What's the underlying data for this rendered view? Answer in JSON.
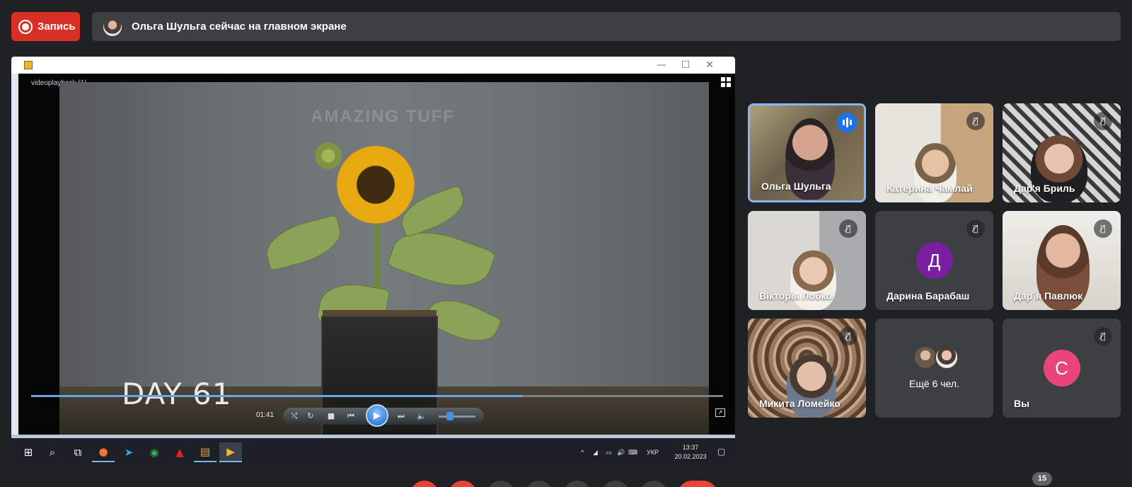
{
  "record_button": {
    "label": "Запись"
  },
  "banner": {
    "text": "Ольга Шульга сейчас на главном экране"
  },
  "shared_screen": {
    "window_controls": {
      "minimize": "—",
      "maximize": "☐",
      "close": "✕"
    },
    "video_title": "videoplayback (1)",
    "watermark": "AMAZING TUFF",
    "day_label": "DAY 61",
    "time": "01:41",
    "progress": 0.71,
    "volume": 0.3,
    "taskbar": {
      "keyboard_lang": "УКР",
      "clock_time": "13:37",
      "clock_date": "20.02.2023"
    }
  },
  "participants": [
    {
      "name": "Ольга Шульга",
      "speaking": true,
      "muted": false
    },
    {
      "name": "Катерина Чамлай",
      "speaking": false,
      "muted": true
    },
    {
      "name": "Дар'я Бриль",
      "speaking": false,
      "muted": true
    },
    {
      "name": "Вікторія Лобко",
      "speaking": false,
      "muted": true
    },
    {
      "name": "Дарина Барабаш",
      "speaking": false,
      "muted": true,
      "initial": "Д",
      "color": "#7b1fa2"
    },
    {
      "name": "Дар`я Павлюк",
      "speaking": false,
      "muted": true
    },
    {
      "name": "Микита Ломейко",
      "speaking": false,
      "muted": true
    },
    {
      "name": "Ещё 6 чел.",
      "group": true
    },
    {
      "name": "Вы",
      "speaking": false,
      "muted": true,
      "initial": "С",
      "color": "#e8457a"
    }
  ],
  "participant_count": "15"
}
